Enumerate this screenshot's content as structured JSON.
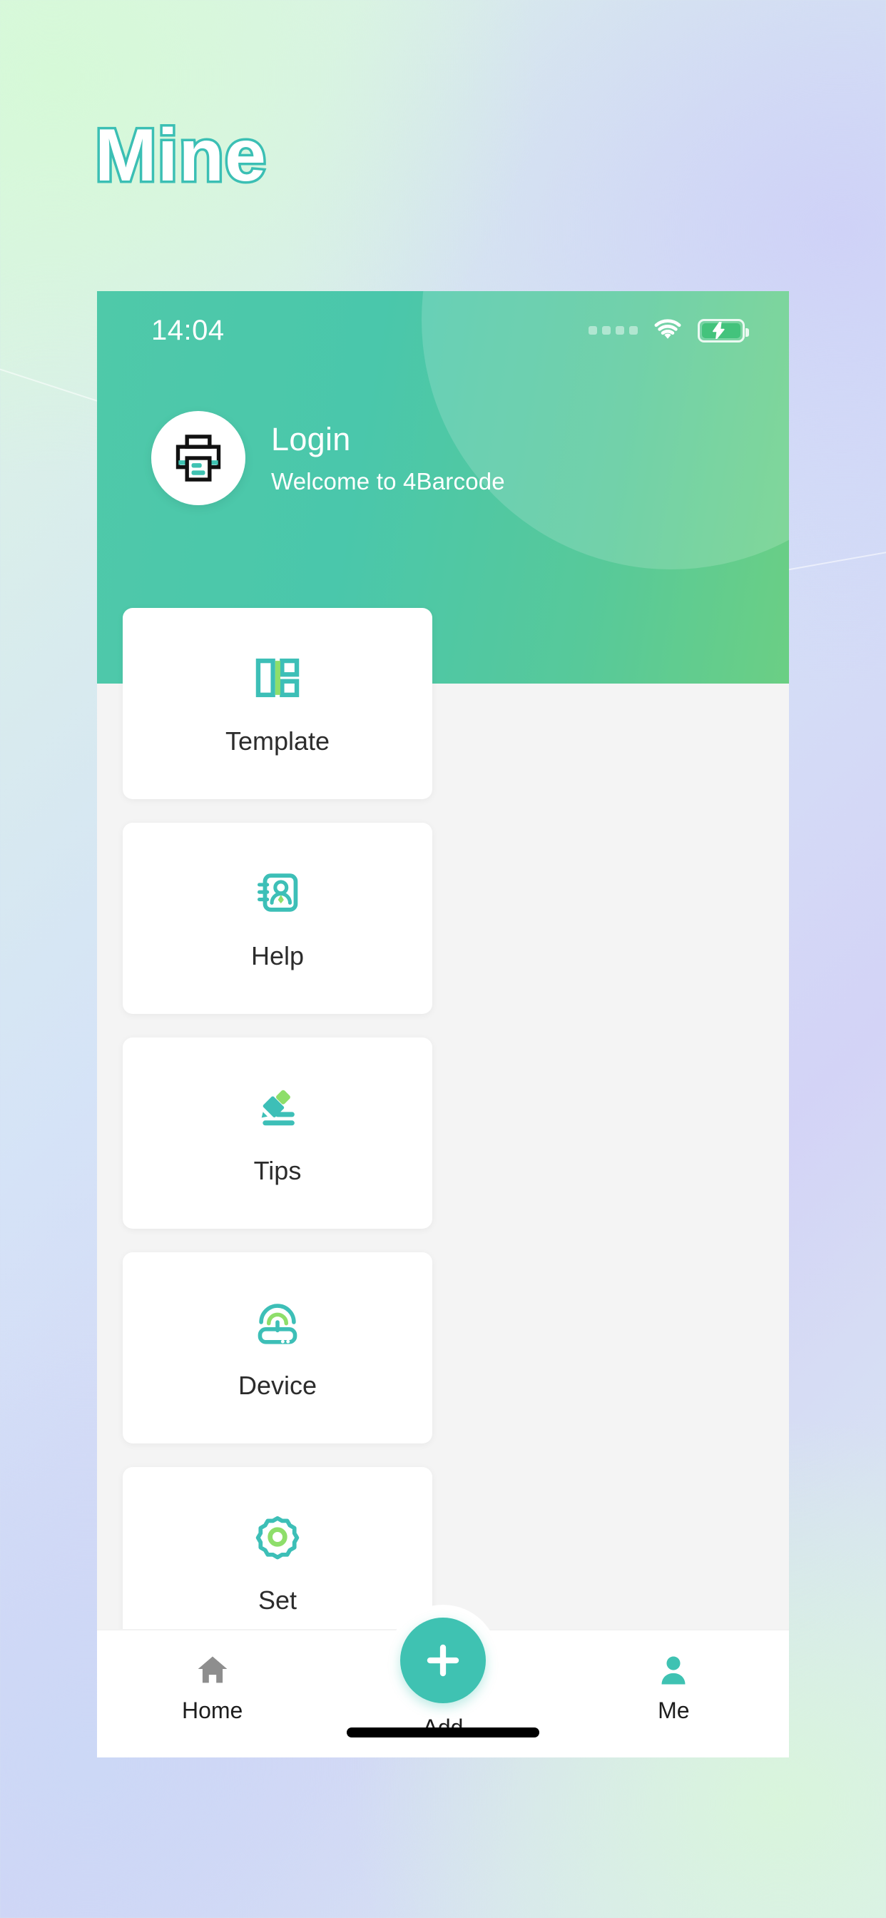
{
  "page": {
    "title": "Mine",
    "title_stroke_color": "#3bbfb4",
    "background_colors": [
      "#ddf7e0",
      "#d5e3f7",
      "#d3d3f6",
      "#dceff0"
    ]
  },
  "statusbar": {
    "time": "14:04",
    "signal_icon": "signal-dots-icon",
    "wifi_icon": "wifi-icon",
    "battery_icon": "battery-charging-icon"
  },
  "header": {
    "accent_gradient": [
      "#4fc9a9",
      "#6bcf84"
    ],
    "avatar_icon": "printer-icon",
    "title": "Login",
    "subtitle": "Welcome to 4Barcode"
  },
  "grid": {
    "cards": [
      {
        "label": "Template",
        "icon": "template-layout-icon"
      },
      {
        "label": "Help",
        "icon": "contact-book-icon"
      },
      {
        "label": "Tips",
        "icon": "pen-writing-icon"
      },
      {
        "label": "Device",
        "icon": "router-signal-icon"
      },
      {
        "label": "Set",
        "icon": "gear-icon"
      }
    ]
  },
  "tabbar": {
    "accent_color": "#3fc2b2",
    "inactive_color": "#8e8e8e",
    "tabs": [
      {
        "label": "Home",
        "icon": "home-icon",
        "active": false
      },
      {
        "label": "Add",
        "icon": "plus-icon",
        "active": false
      },
      {
        "label": "Me",
        "icon": "person-icon",
        "active": true
      }
    ]
  }
}
